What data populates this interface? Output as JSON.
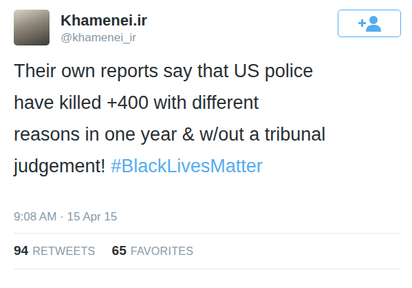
{
  "profile": {
    "name": "Khamenei.ir",
    "handle": "@khamenei_ir"
  },
  "tweet": {
    "lines": [
      "Their own reports say that US police",
      "have killed +400 with different",
      "reasons in one year & w/out a tribunal",
      "judgement!"
    ],
    "hashtag": "#BlackLivesMatter",
    "timestamp": "9:08 AM · 15 Apr 15"
  },
  "stats": [
    {
      "count": "94",
      "label": "RETWEETS"
    },
    {
      "count": "65",
      "label": "FAVORITES"
    }
  ]
}
